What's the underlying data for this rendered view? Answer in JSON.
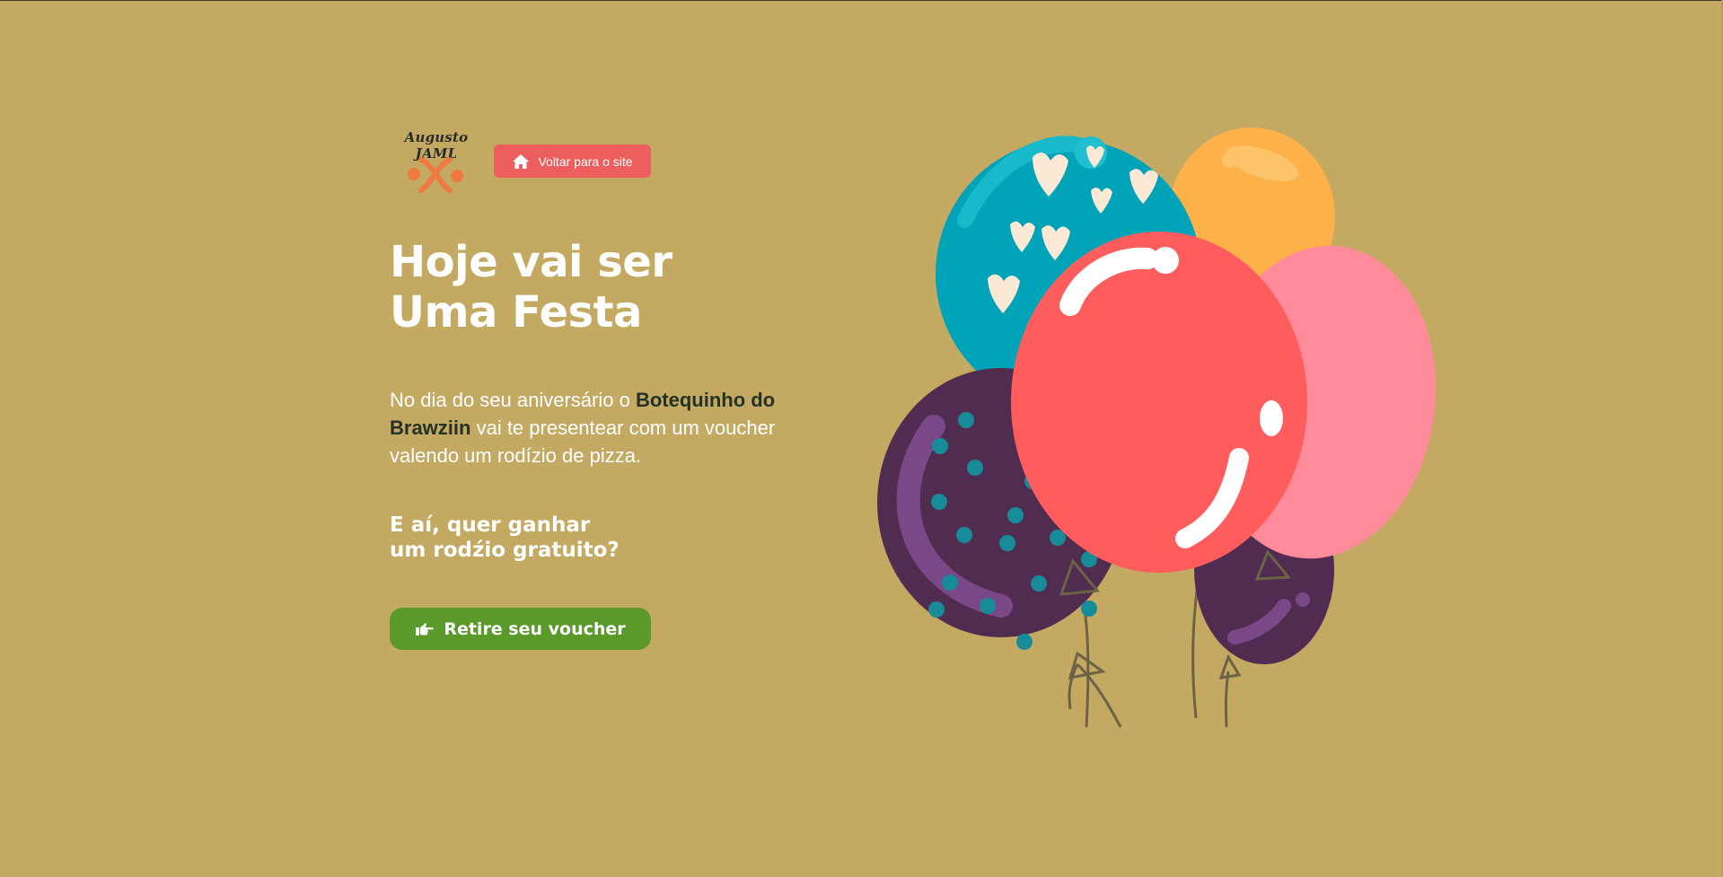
{
  "logo": {
    "text": "Augusto JAML",
    "icon": "swirl-logo-icon"
  },
  "back_button": {
    "label": "Voltar para o site",
    "icon": "home-icon"
  },
  "hero": {
    "title_line1": "Hoje vai ser",
    "title_line2": "Uma Festa",
    "desc_part1": "No dia do seu aniversário o ",
    "desc_bold": "Botequinho do Brawziin",
    "desc_part2": " vai te presentear com um voucher valendo um rodízio de pizza.",
    "question_line1": "E aí, quer ganhar",
    "question_line2": "um rodźio gratuito?"
  },
  "cta": {
    "label": "Retire seu voucher",
    "icon": "pointing-hand-icon"
  },
  "colors": {
    "background": "#c3a962",
    "back_button": "#ec5f5e",
    "cta": "#5a9a2a",
    "bold_text": "#243126"
  },
  "illustration": "balloons-illustration"
}
